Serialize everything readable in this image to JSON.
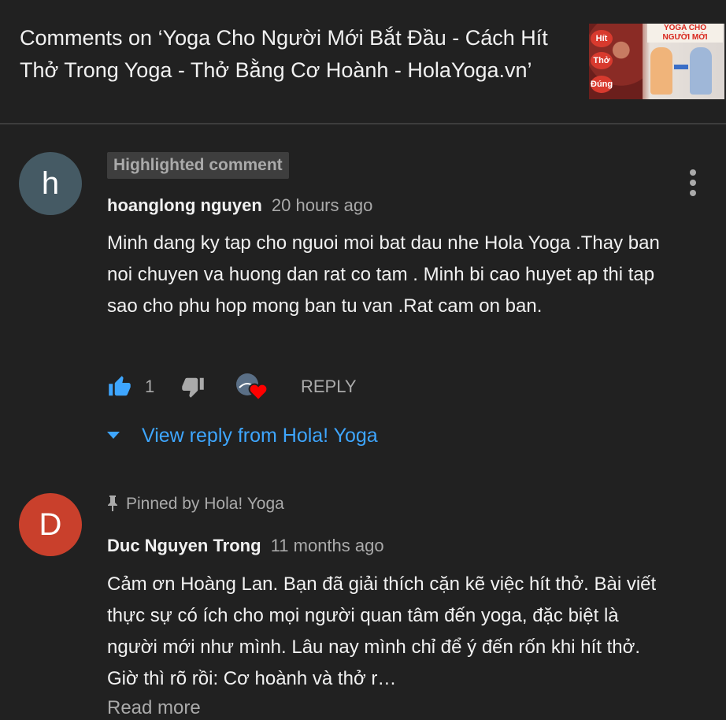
{
  "header": {
    "title": "Comments on ‘Yoga Cho Người Mới Bắt Đầu - Cách Hít Thở Trong Yoga - Thở Bằng Cơ Hoành - HolaYoga.vn’",
    "thumbnail": {
      "title_line1": "YOGA CHO",
      "title_line2": "NGƯỜI MỚI",
      "words": [
        "Hít",
        "Thở",
        "Đúng"
      ]
    }
  },
  "comments": [
    {
      "badge": "Highlighted comment",
      "avatar_letter": "h",
      "avatar_color": "#455a64",
      "author": "hoanglong nguyen",
      "time": "20 hours ago",
      "text": "Minh dang ky tap cho nguoi moi bat dau nhe  Hola Yoga .Thay ban noi chuyen va huong dan rat co tam . Minh bi cao huyet ap thi tap sao cho phu hop mong ban tu van .Rat cam on ban.",
      "like_count": "1",
      "reply_label": "REPLY",
      "view_reply": "View reply from Hola! Yoga"
    },
    {
      "pinned_label": "Pinned by Hola! Yoga",
      "avatar_letter": "D",
      "avatar_color": "#c9402c",
      "author": "Duc Nguyen Trong",
      "time": "11 months ago",
      "text": "Cảm ơn Hoàng Lan. Bạn đã giải thích cặn kẽ việc hít thở. Bài viết thực sự có ích cho mọi người quan tâm đến yoga, đặc biệt là người mới như mình. Lâu nay mình chỉ để ý đến rốn khi hít thở. Giờ thì rõ rồi: Cơ hoành và thở r…",
      "read_more": "Read more"
    }
  ],
  "colors": {
    "background": "#212121",
    "link": "#3ea6ff",
    "like_active": "#3ea6ff",
    "heart": "#ff0000"
  }
}
